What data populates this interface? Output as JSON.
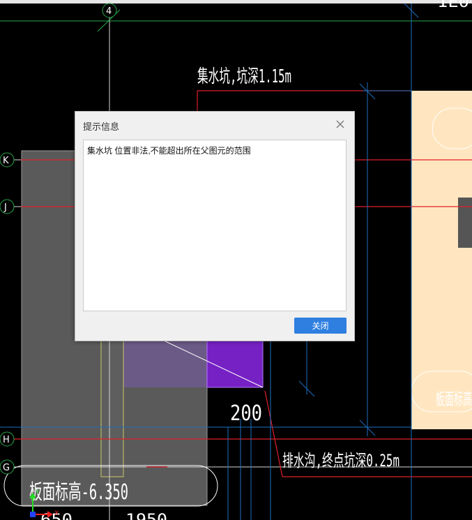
{
  "cad": {
    "grid_labels": {
      "col_4": "4",
      "row_K": "K",
      "row_J": "J",
      "row_H": "H",
      "row_G": "G"
    },
    "annotations": {
      "pit_label": "集水坑,坑深1.15m",
      "trench_label": "排水沟,终点坑深0.25m",
      "dim_200": "200",
      "slab_elev_left": "板面标高-6.350",
      "slab_elev_right": "板面标高",
      "top_right_partial": "1E0",
      "bottom_left_partial": "650",
      "bottom_mid_partial": "1950"
    },
    "ucs": {
      "x_label": "X",
      "y_label": "Y"
    },
    "colors": {
      "background": "#000000",
      "grid_line": "#ffffff",
      "red_line": "#e0202a",
      "cyan_line": "#1e6fbf",
      "slab_gray": "#5b5b5b",
      "pit_purple": "#7b1fc8",
      "slab_beige": "#ffe6c0"
    }
  },
  "dialog": {
    "title": "提示信息",
    "close_icon": "close-icon",
    "message": "集水坑 位置非法,不能超出所在父图元的范围",
    "close_button_label": "关闭"
  }
}
